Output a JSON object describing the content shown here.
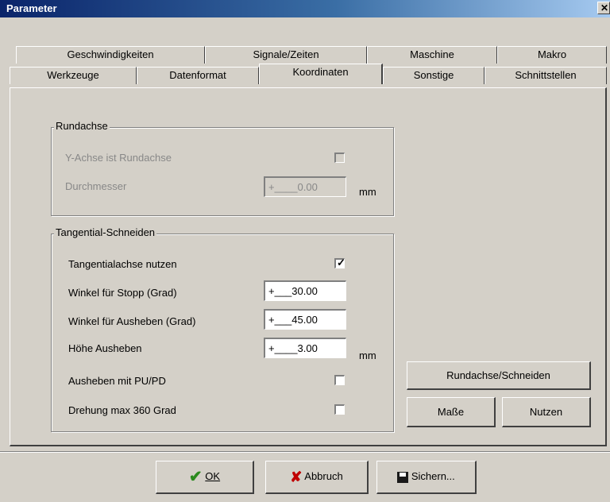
{
  "window": {
    "title": "Parameter",
    "close_glyph": "✕"
  },
  "tabs_row1": [
    "Geschwindigkeiten",
    "Signale/Zeiten",
    "Maschine",
    "Makro"
  ],
  "tabs_row2": [
    "Werkzeuge",
    "Datenformat",
    "Koordinaten",
    "Sonstige",
    "Schnittstellen"
  ],
  "active_tab": "Koordinaten",
  "rundachse": {
    "label": "Rundachse",
    "y_axis_label": "Y-Achse ist Rundachse",
    "y_axis_checked": false,
    "diameter_label": "Durchmesser",
    "diameter_value": "+____0.00",
    "diameter_unit": "mm"
  },
  "tangential": {
    "label": "Tangential-Schneiden",
    "use_axis_label": "Tangentialachse nutzen",
    "use_axis_checked": true,
    "stop_angle_label": "Winkel für Stopp (Grad)",
    "stop_angle_value": "+___30.00",
    "lift_angle_label": "Winkel für Ausheben (Grad)",
    "lift_angle_value": "+___45.00",
    "lift_height_label": "Höhe Ausheben",
    "lift_height_value": "+____3.00",
    "lift_height_unit": "mm",
    "pu_pd_label": "Ausheben mit PU/PD",
    "pu_pd_checked": false,
    "rotation_label": "Drehung max 360 Grad",
    "rotation_checked": false
  },
  "side_buttons": {
    "rundachse_schneiden": "Rundachse/Schneiden",
    "masse": "Maße",
    "nutzen": "Nutzen"
  },
  "footer": {
    "ok_label": "OK",
    "cancel_label": "Abbruch",
    "save_label": "Sichern..."
  },
  "colors": {
    "face": "#d4d0c8",
    "title_start": "#0a246a",
    "title_end": "#a6caf0",
    "ok_icon": "#2b8a1e",
    "cancel_icon": "#c00000"
  }
}
